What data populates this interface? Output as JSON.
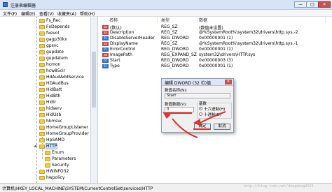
{
  "window": {
    "title": "注册表编辑器",
    "minimize": "—",
    "maximize": "□",
    "close": "✕"
  },
  "menu": [
    "文件(F)",
    "编辑(E)",
    "查看(V)",
    "收藏夹(A)",
    "帮助(H)"
  ],
  "tree": {
    "items": [
      {
        "label": "Fs_Rec",
        "expander": ""
      },
      {
        "label": "FxDepends",
        "expander": ""
      },
      {
        "label": "fvevol",
        "expander": ""
      },
      {
        "label": "gagp30kx",
        "expander": ""
      },
      {
        "label": "gpsvc",
        "expander": ""
      },
      {
        "label": "gupdate",
        "expander": ""
      },
      {
        "label": "gupdatem",
        "expander": ""
      },
      {
        "label": "hcmon",
        "expander": ""
      },
      {
        "label": "hcw85cir",
        "expander": ""
      },
      {
        "label": "HdAudAddService",
        "expander": ""
      },
      {
        "label": "HDAudBus",
        "expander": ""
      },
      {
        "label": "HidBatt",
        "expander": ""
      },
      {
        "label": "HidBth",
        "expander": ""
      },
      {
        "label": "HidIr",
        "expander": ""
      },
      {
        "label": "hidserv",
        "expander": ""
      },
      {
        "label": "HidUsb",
        "expander": ""
      },
      {
        "label": "hkmsvc",
        "expander": ""
      },
      {
        "label": "HomeGroupListener",
        "expander": ""
      },
      {
        "label": "HomeGroupProvider",
        "expander": ""
      },
      {
        "label": "HpSAMD",
        "expander": ""
      },
      {
        "label": "HTTP",
        "expander": "◢"
      },
      {
        "label": "Enum",
        "expander": ""
      },
      {
        "label": "Parameters",
        "expander": ""
      },
      {
        "label": "Security",
        "expander": ""
      },
      {
        "label": "HWiNFO32",
        "expander": ""
      },
      {
        "label": "hwpolicy",
        "expander": ""
      }
    ]
  },
  "list": {
    "headers": {
      "name": "名称",
      "type": "类型",
      "data": "数据"
    },
    "rows": [
      {
        "icon": "ab",
        "name": "(默认)",
        "type": "REG_SZ",
        "data": "(数值未设置)"
      },
      {
        "icon": "ab",
        "name": "Description",
        "type": "REG_SZ",
        "data": "@%SystemRoot%\\system32\\drivers\\http.sys,-2"
      },
      {
        "icon": "01",
        "name": "DisableServerHeader",
        "type": "REG_DWORD",
        "data": "0x00000001 (1)"
      },
      {
        "icon": "ab",
        "name": "DisplayName",
        "type": "REG_SZ",
        "data": "@%SystemRoot%\\system32\\drivers\\http.sys,-1"
      },
      {
        "icon": "01",
        "name": "ErrorControl",
        "type": "REG_DWORD",
        "data": "0x00000001 (1)"
      },
      {
        "icon": "ab",
        "name": "ImagePath",
        "type": "REG_EXPAND_SZ",
        "data": "system32\\drivers\\HTTP.sys"
      },
      {
        "icon": "01",
        "name": "Start",
        "type": "REG_DWORD",
        "data": "0x00000003 (3)"
      },
      {
        "icon": "01",
        "name": "Type",
        "type": "REG_DWORD",
        "data": "0x00000001 (1)"
      }
    ]
  },
  "dialog": {
    "title": "编辑 DWORD (32 位)值",
    "close": "✕",
    "name_label": "数值名称(N):",
    "name_value": "Start",
    "data_label": "数值数据(V):",
    "data_value": "0",
    "base_label": "基数",
    "hex_label": "十六进制(H)",
    "dec_label": "十进制(D)",
    "ok_label": "确定",
    "cancel_label": "取消"
  },
  "status": {
    "path": "计算机\\HKEY_LOCAL_MACHINE\\SYSTEM\\CurrentControlSet\\services\\HTTP"
  },
  "watermark": "http://blog.csdn.net/dongdong9223",
  "colors": {
    "accent": "#e3312b",
    "selection": "#cde4fb",
    "folder": "#f3c94b"
  }
}
